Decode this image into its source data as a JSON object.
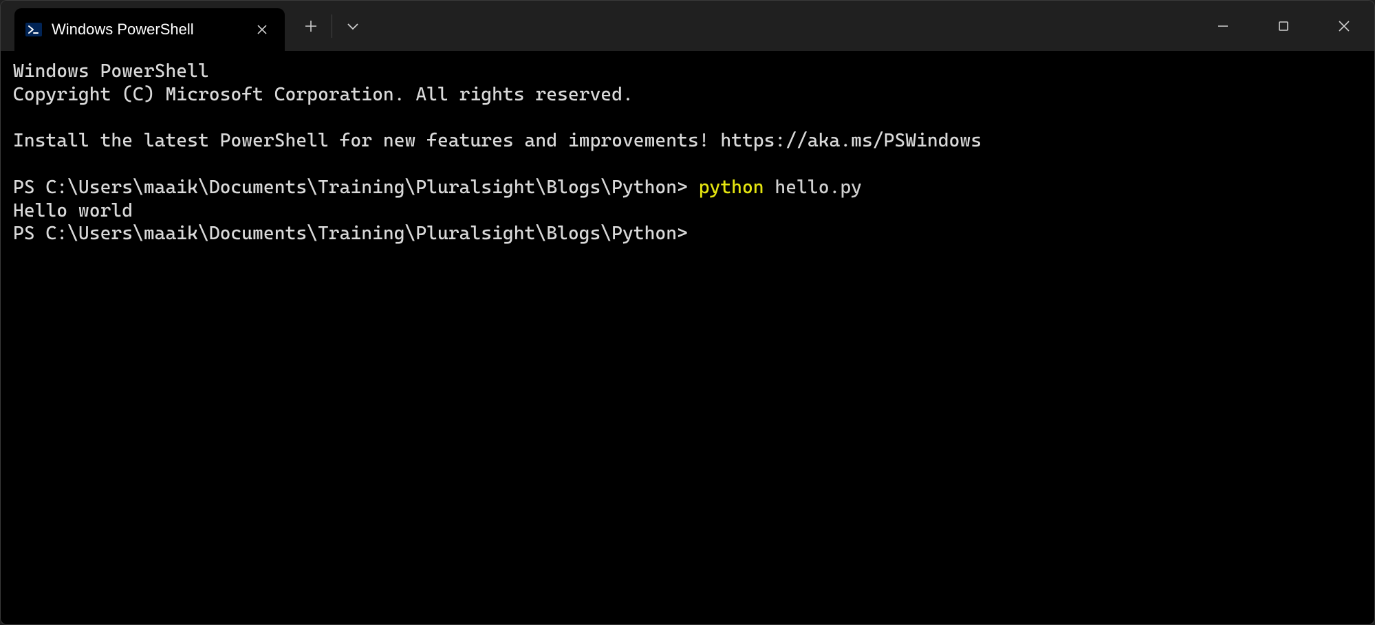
{
  "tab": {
    "title": "Windows PowerShell"
  },
  "terminal": {
    "banner_line1": "Windows PowerShell",
    "banner_line2": "Copyright (C) Microsoft Corporation. All rights reserved.",
    "banner_line3": "Install the latest PowerShell for new features and improvements! https://aka.ms/PSWindows",
    "prompt1": "PS C:\\Users\\maaik\\Documents\\Training\\Pluralsight\\Blogs\\Python> ",
    "command_exe": "python",
    "command_arg": " hello.py",
    "output1": "Hello world",
    "prompt2": "PS C:\\Users\\maaik\\Documents\\Training\\Pluralsight\\Blogs\\Python>"
  }
}
